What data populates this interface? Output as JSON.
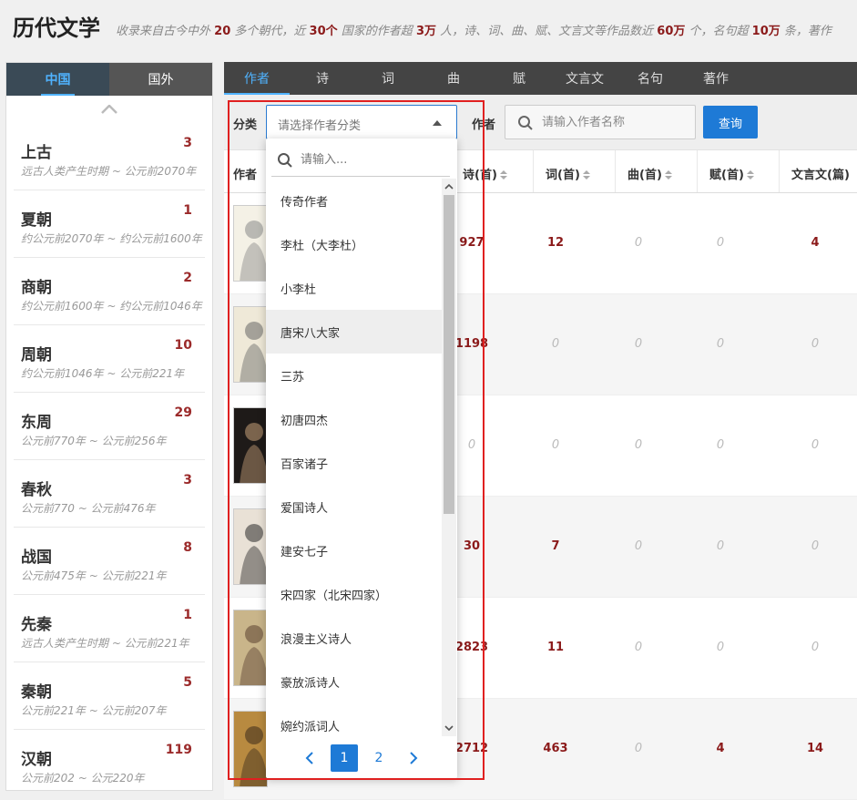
{
  "header": {
    "title": "历代文学",
    "desc_parts": [
      "收录来自古今中外",
      "20",
      "多个朝代，近",
      "30个",
      "国家的作者超",
      "3万",
      "人，诗、词、曲、赋、文言文等作品数近",
      "60万",
      "个，名句超",
      "10万",
      "条，著作"
    ]
  },
  "sidebar": {
    "tabs": [
      {
        "label": "中国",
        "active": true
      },
      {
        "label": "国外",
        "active": false
      }
    ],
    "eras": [
      {
        "name": "上古",
        "count": "3",
        "range": "远古人类产生时期 ~ 公元前2070年"
      },
      {
        "name": "夏朝",
        "count": "1",
        "range": "约公元前2070年 ~ 约公元前1600年"
      },
      {
        "name": "商朝",
        "count": "2",
        "range": "约公元前1600年 ~ 约公元前1046年"
      },
      {
        "name": "周朝",
        "count": "10",
        "range": "约公元前1046年 ~ 公元前221年"
      },
      {
        "name": "东周",
        "count": "29",
        "range": "公元前770年 ~ 公元前256年"
      },
      {
        "name": "春秋",
        "count": "3",
        "range": "公元前770 ~ 公元前476年"
      },
      {
        "name": "战国",
        "count": "8",
        "range": "公元前475年 ~ 公元前221年"
      },
      {
        "name": "先秦",
        "count": "1",
        "range": "远古人类产生时期 ~ 公元前221年"
      },
      {
        "name": "秦朝",
        "count": "5",
        "range": "公元前221年 ~ 公元前207年"
      },
      {
        "name": "汉朝",
        "count": "119",
        "range": "公元前202 ~ 公元220年"
      }
    ]
  },
  "top_tabs": [
    "作者",
    "诗",
    "词",
    "曲",
    "赋",
    "文言文",
    "名句",
    "著作"
  ],
  "filter": {
    "category_label": "分类",
    "category_placeholder": "请选择作者分类",
    "author_label": "作者",
    "author_placeholder": "请输入作者名称",
    "query_label": "查询"
  },
  "table": {
    "headers": [
      "作者",
      "诗(首)",
      "词(首)",
      "曲(首)",
      "赋(首)",
      "文言文(篇)"
    ],
    "rows": [
      {
        "poem": "927",
        "ci": "12",
        "qu": "0",
        "fu": "0",
        "wyw": "4"
      },
      {
        "poem": "1198",
        "ci": "0",
        "qu": "0",
        "fu": "0",
        "wyw": "0"
      },
      {
        "poem": "0",
        "ci": "0",
        "qu": "0",
        "fu": "0",
        "wyw": "0"
      },
      {
        "poem": "30",
        "ci": "7",
        "qu": "0",
        "fu": "0",
        "wyw": "0"
      },
      {
        "poem": "2823",
        "ci": "11",
        "qu": "0",
        "fu": "0",
        "wyw": "0"
      },
      {
        "poem": "2712",
        "ci": "463",
        "qu": "0",
        "fu": "4",
        "wyw": "14"
      }
    ]
  },
  "dropdown": {
    "search_placeholder": "请输入...",
    "items": [
      "传奇作者",
      "李杜（大李杜）",
      "小李杜",
      "唐宋八大家",
      "三苏",
      "初唐四杰",
      "百家诸子",
      "爱国诗人",
      "建安七子",
      "宋四家（北宋四家）",
      "浪漫主义诗人",
      "豪放派诗人",
      "婉约派词人"
    ],
    "hovered_index": 3,
    "pages": [
      "1",
      "2"
    ],
    "current_page": "1"
  }
}
